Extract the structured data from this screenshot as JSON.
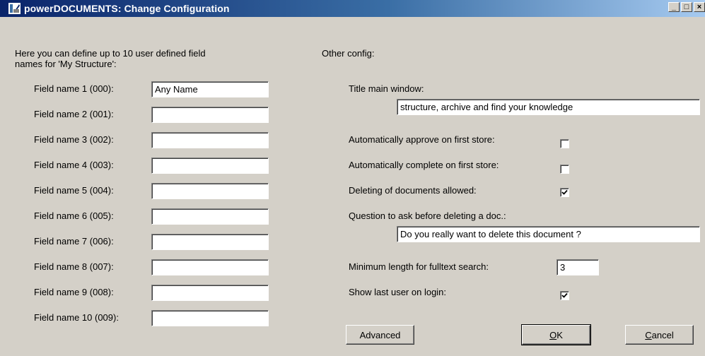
{
  "window": {
    "title": "powerDOCUMENTS: Change Configuration",
    "minimize_glyph": "_",
    "maximize_glyph": "□",
    "close_glyph": "×"
  },
  "left": {
    "intro_line1": "Here you can define up to 10 user defined field",
    "intro_line2": "names for 'My Structure':",
    "fields": [
      {
        "label": "Field name 1 (000):",
        "value": "Any Name"
      },
      {
        "label": "Field name 2 (001):",
        "value": ""
      },
      {
        "label": "Field name 3 (002):",
        "value": ""
      },
      {
        "label": "Field name 4 (003):",
        "value": ""
      },
      {
        "label": "Field name 5 (004):",
        "value": ""
      },
      {
        "label": "Field name 6 (005):",
        "value": ""
      },
      {
        "label": "Field name 7 (006):",
        "value": ""
      },
      {
        "label": "Field name 8 (007):",
        "value": ""
      },
      {
        "label": "Field name 9 (008):",
        "value": ""
      },
      {
        "label": "Field name 10 (009):",
        "value": ""
      }
    ]
  },
  "right": {
    "heading": "Other config:",
    "title_main_label": "Title main window:",
    "title_main_value": "structure, archive and find your knowledge",
    "auto_approve_label": "Automatically approve on first store:",
    "auto_approve_checked": false,
    "auto_complete_label": "Automatically complete on first store:",
    "auto_complete_checked": false,
    "delete_allowed_label": "Deleting of documents allowed:",
    "delete_allowed_checked": true,
    "question_label": "Question to ask before deleting a doc.:",
    "question_value": "Do you really want to delete this document ?",
    "min_length_label": "Minimum length for fulltext search:",
    "min_length_value": "3",
    "show_last_user_label": "Show last user on login:",
    "show_last_user_checked": true
  },
  "buttons": {
    "advanced": "Advanced",
    "ok_mnemonic": "O",
    "ok_rest": "K",
    "cancel_mnemonic": "C",
    "cancel_rest": "ancel"
  },
  "colors": {
    "titlebar_start": "#0a246a",
    "titlebar_end": "#a6caf0",
    "face": "#d4d0c8"
  }
}
